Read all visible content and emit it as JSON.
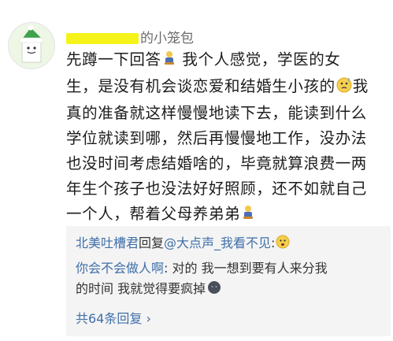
{
  "post": {
    "username_visible": "的小笼包",
    "paragraph": {
      "l1a": "先蹲一下回答",
      "l1b": " 我个人感觉，学医的女",
      "l2a": "生，是没有机会谈恋爱和结婚生小孩的",
      "l2b": "我",
      "l3": "真的准备就这样慢慢地读下去，能读到什么",
      "l4": "学位就读到哪，然后再慢慢地工作，没办法",
      "l5": "也没时间考虑结婚啥的，毕竟就算浪费一两",
      "l6": "年生个孩子也没法好好照顾，还不如就自己",
      "l7": "一个人，帮着父母养弟弟"
    }
  },
  "replies": [
    {
      "author": "北美吐槽君",
      "verb": "回复",
      "target": "@大点声_我看不见",
      "colon": ":",
      "text": ""
    },
    {
      "author": "你会不会做人啊",
      "colon": ": ",
      "text_l1": "对的 我一想到要有人来分我",
      "text_l2": "的时间 我就觉得要疯掉"
    }
  ],
  "more_replies": "共64条回复 ›",
  "icons": [
    "avatar-ghost-icon",
    "crouch-emoji-icon",
    "confused-emoji-icon",
    "sweat-emoji-icon",
    "dark-face-emoji-icon"
  ],
  "colors": {
    "link": "#3f6fa8",
    "mask": "#f5f31a",
    "reply_bg": "#f4f4f4"
  }
}
